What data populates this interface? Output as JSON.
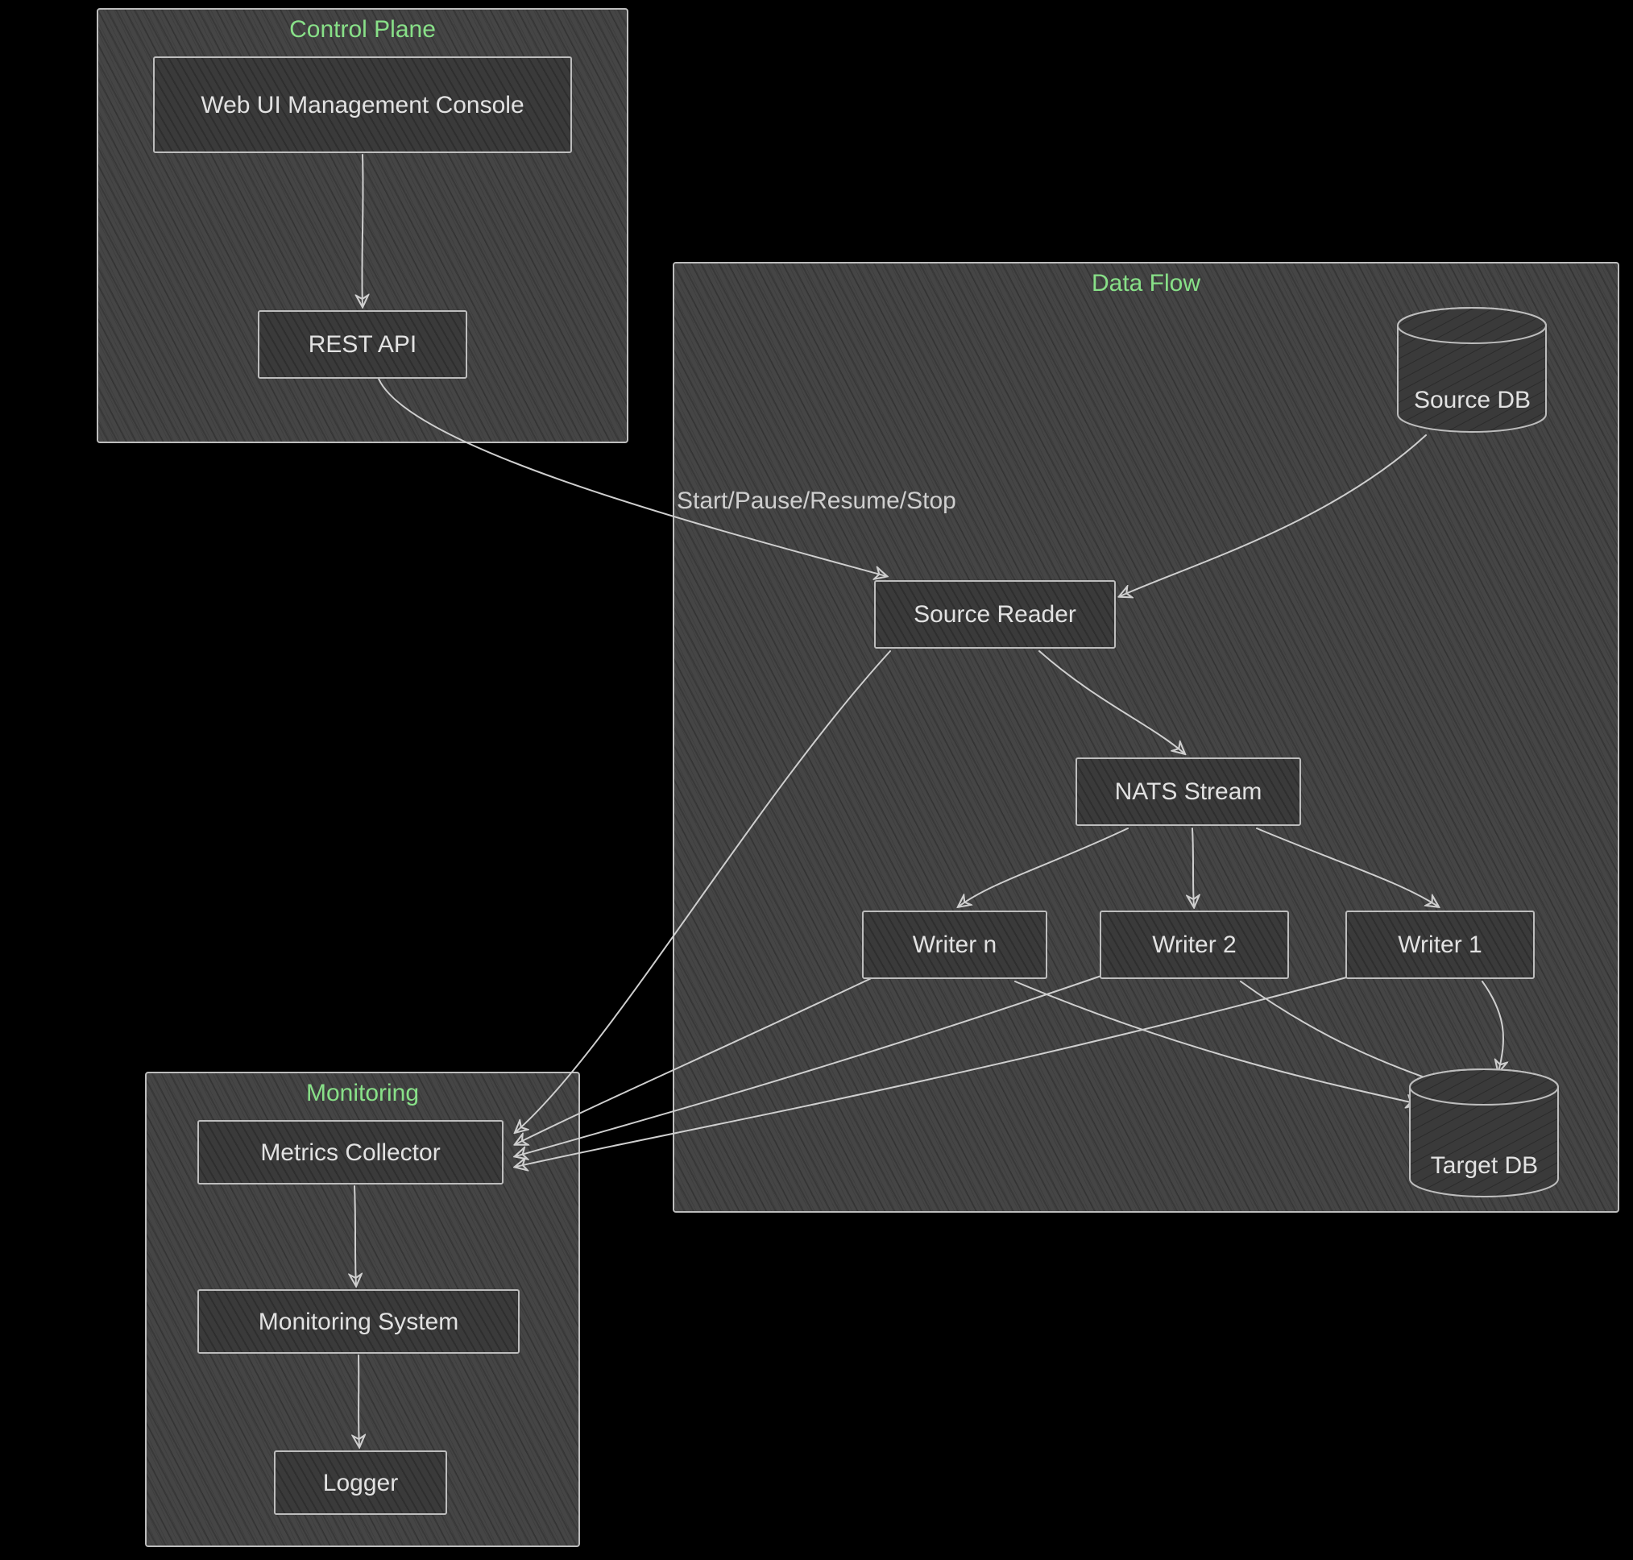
{
  "groups": {
    "control_plane": {
      "title": "Control Plane"
    },
    "data_flow": {
      "title": "Data Flow"
    },
    "monitoring": {
      "title": "Monitoring"
    }
  },
  "nodes": {
    "web_ui": "Web UI Management Console",
    "rest_api": "REST API",
    "source_db": "Source DB",
    "source_reader": "Source Reader",
    "nats_stream": "NATS Stream",
    "writer_n": "Writer n",
    "writer_2": "Writer 2",
    "writer_1": "Writer 1",
    "target_db": "Target DB",
    "metrics": "Metrics Collector",
    "mon_system": "Monitoring System",
    "logger": "Logger"
  },
  "edge_labels": {
    "start_pause": "Start/Pause/Resume/Stop"
  },
  "chart_data": {
    "type": "diagram",
    "title": "System architecture – control plane, data flow, monitoring",
    "clusters": [
      {
        "id": "control_plane",
        "label": "Control Plane",
        "nodes": [
          "web_ui",
          "rest_api"
        ]
      },
      {
        "id": "data_flow",
        "label": "Data Flow",
        "nodes": [
          "source_db",
          "source_reader",
          "nats_stream",
          "writer_n",
          "writer_2",
          "writer_1",
          "target_db"
        ]
      },
      {
        "id": "monitoring",
        "label": "Monitoring",
        "nodes": [
          "metrics",
          "mon_system",
          "logger"
        ]
      }
    ],
    "nodes": [
      {
        "id": "web_ui",
        "label": "Web UI Management Console",
        "shape": "rect",
        "cluster": "control_plane"
      },
      {
        "id": "rest_api",
        "label": "REST API",
        "shape": "rect",
        "cluster": "control_plane"
      },
      {
        "id": "source_db",
        "label": "Source DB",
        "shape": "cylinder",
        "cluster": "data_flow"
      },
      {
        "id": "source_reader",
        "label": "Source Reader",
        "shape": "rect",
        "cluster": "data_flow"
      },
      {
        "id": "nats_stream",
        "label": "NATS Stream",
        "shape": "rect",
        "cluster": "data_flow"
      },
      {
        "id": "writer_n",
        "label": "Writer n",
        "shape": "rect",
        "cluster": "data_flow"
      },
      {
        "id": "writer_2",
        "label": "Writer 2",
        "shape": "rect",
        "cluster": "data_flow"
      },
      {
        "id": "writer_1",
        "label": "Writer 1",
        "shape": "rect",
        "cluster": "data_flow"
      },
      {
        "id": "target_db",
        "label": "Target DB",
        "shape": "cylinder",
        "cluster": "data_flow"
      },
      {
        "id": "metrics",
        "label": "Metrics Collector",
        "shape": "rect",
        "cluster": "monitoring"
      },
      {
        "id": "mon_system",
        "label": "Monitoring System",
        "shape": "rect",
        "cluster": "monitoring"
      },
      {
        "id": "logger",
        "label": "Logger",
        "shape": "rect",
        "cluster": "monitoring"
      }
    ],
    "edges": [
      {
        "from": "web_ui",
        "to": "rest_api"
      },
      {
        "from": "rest_api",
        "to": "source_reader",
        "label": "Start/Pause/Resume/Stop"
      },
      {
        "from": "source_db",
        "to": "source_reader"
      },
      {
        "from": "source_reader",
        "to": "nats_stream"
      },
      {
        "from": "nats_stream",
        "to": "writer_n"
      },
      {
        "from": "nats_stream",
        "to": "writer_2"
      },
      {
        "from": "nats_stream",
        "to": "writer_1"
      },
      {
        "from": "writer_n",
        "to": "target_db"
      },
      {
        "from": "writer_2",
        "to": "target_db"
      },
      {
        "from": "writer_1",
        "to": "target_db"
      },
      {
        "from": "source_reader",
        "to": "metrics"
      },
      {
        "from": "writer_n",
        "to": "metrics"
      },
      {
        "from": "writer_2",
        "to": "metrics"
      },
      {
        "from": "writer_1",
        "to": "metrics"
      },
      {
        "from": "metrics",
        "to": "mon_system"
      },
      {
        "from": "mon_system",
        "to": "logger"
      }
    ]
  }
}
